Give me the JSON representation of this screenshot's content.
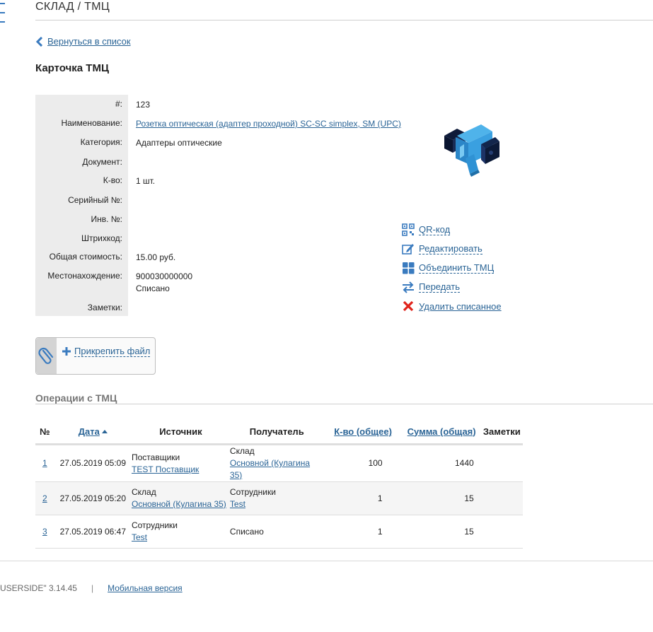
{
  "header": {
    "title": "СКЛАД / ТМЦ"
  },
  "back_link": {
    "label": "Вернуться в список"
  },
  "card": {
    "title": "Карточка ТМЦ",
    "fields": [
      {
        "label": "#:",
        "value": "123"
      },
      {
        "label": "Наименование:",
        "value": "Розетка оптическая (адаптер проходной) SC-SC simplex, SM (UPC)"
      },
      {
        "label": "Категория:",
        "value": "Адаптеры оптические"
      },
      {
        "label": "Документ:",
        "value": ""
      },
      {
        "label": "К-во:",
        "value": "1 шт."
      },
      {
        "label": "Серийный №:",
        "value": ""
      },
      {
        "label": "Инв. №:",
        "value": ""
      },
      {
        "label": "Штрихкод:",
        "value": ""
      },
      {
        "label": "Общая стоимость:",
        "value": "15.00 руб."
      },
      {
        "label": "Местонахождение:",
        "value": "900030000000",
        "value2": "Списано"
      },
      {
        "label": "Заметки:",
        "value": ""
      }
    ]
  },
  "actions": [
    {
      "label": "QR-код",
      "icon": "qr-code-icon"
    },
    {
      "label": "Редактировать",
      "icon": "edit-icon"
    },
    {
      "label": "Объединить ТМЦ",
      "icon": "merge-icon"
    },
    {
      "label": "Передать",
      "icon": "transfer-icon"
    },
    {
      "label": "Удалить списанное",
      "icon": "delete-icon"
    }
  ],
  "attach": {
    "label": "Прикрепить файл"
  },
  "operations": {
    "title": "Операции с ТМЦ",
    "columns": {
      "no": "№",
      "date": "Дата",
      "source": "Источник",
      "receiver": "Получатель",
      "qty": "К-во (общее)",
      "sum": "Сумма (общая)",
      "notes": "Заметки"
    },
    "rows": [
      {
        "no": "1",
        "date": "27.05.2019 05:09",
        "source_type": "Поставщики",
        "source_link": "TEST Поставщик",
        "receiver_type": "Склад",
        "receiver_link": "Основной (Кулагина 35)",
        "qty": "100",
        "sum": "1440",
        "notes": ""
      },
      {
        "no": "2",
        "date": "27.05.2019 05:20",
        "source_type": "Склад",
        "source_link": "Основной (Кулагина 35)",
        "receiver_type": "Сотрудники",
        "receiver_link": "Test",
        "qty": "1",
        "sum": "15",
        "notes": ""
      },
      {
        "no": "3",
        "date": "27.05.2019 06:47",
        "source_type": "Сотрудники",
        "source_link": "Test",
        "receiver_type": "Списано",
        "receiver_link": "",
        "qty": "1",
        "sum": "15",
        "notes": ""
      }
    ]
  },
  "footer": {
    "version": "USERSIDE\" 3.14.45",
    "separator": "|",
    "mobile_link": "Мобильная версия"
  },
  "colors": {
    "link": "#2a6496",
    "accent_blue": "#3a7bbf",
    "delete_red": "#e0231b",
    "label_bg": "#ececec"
  }
}
